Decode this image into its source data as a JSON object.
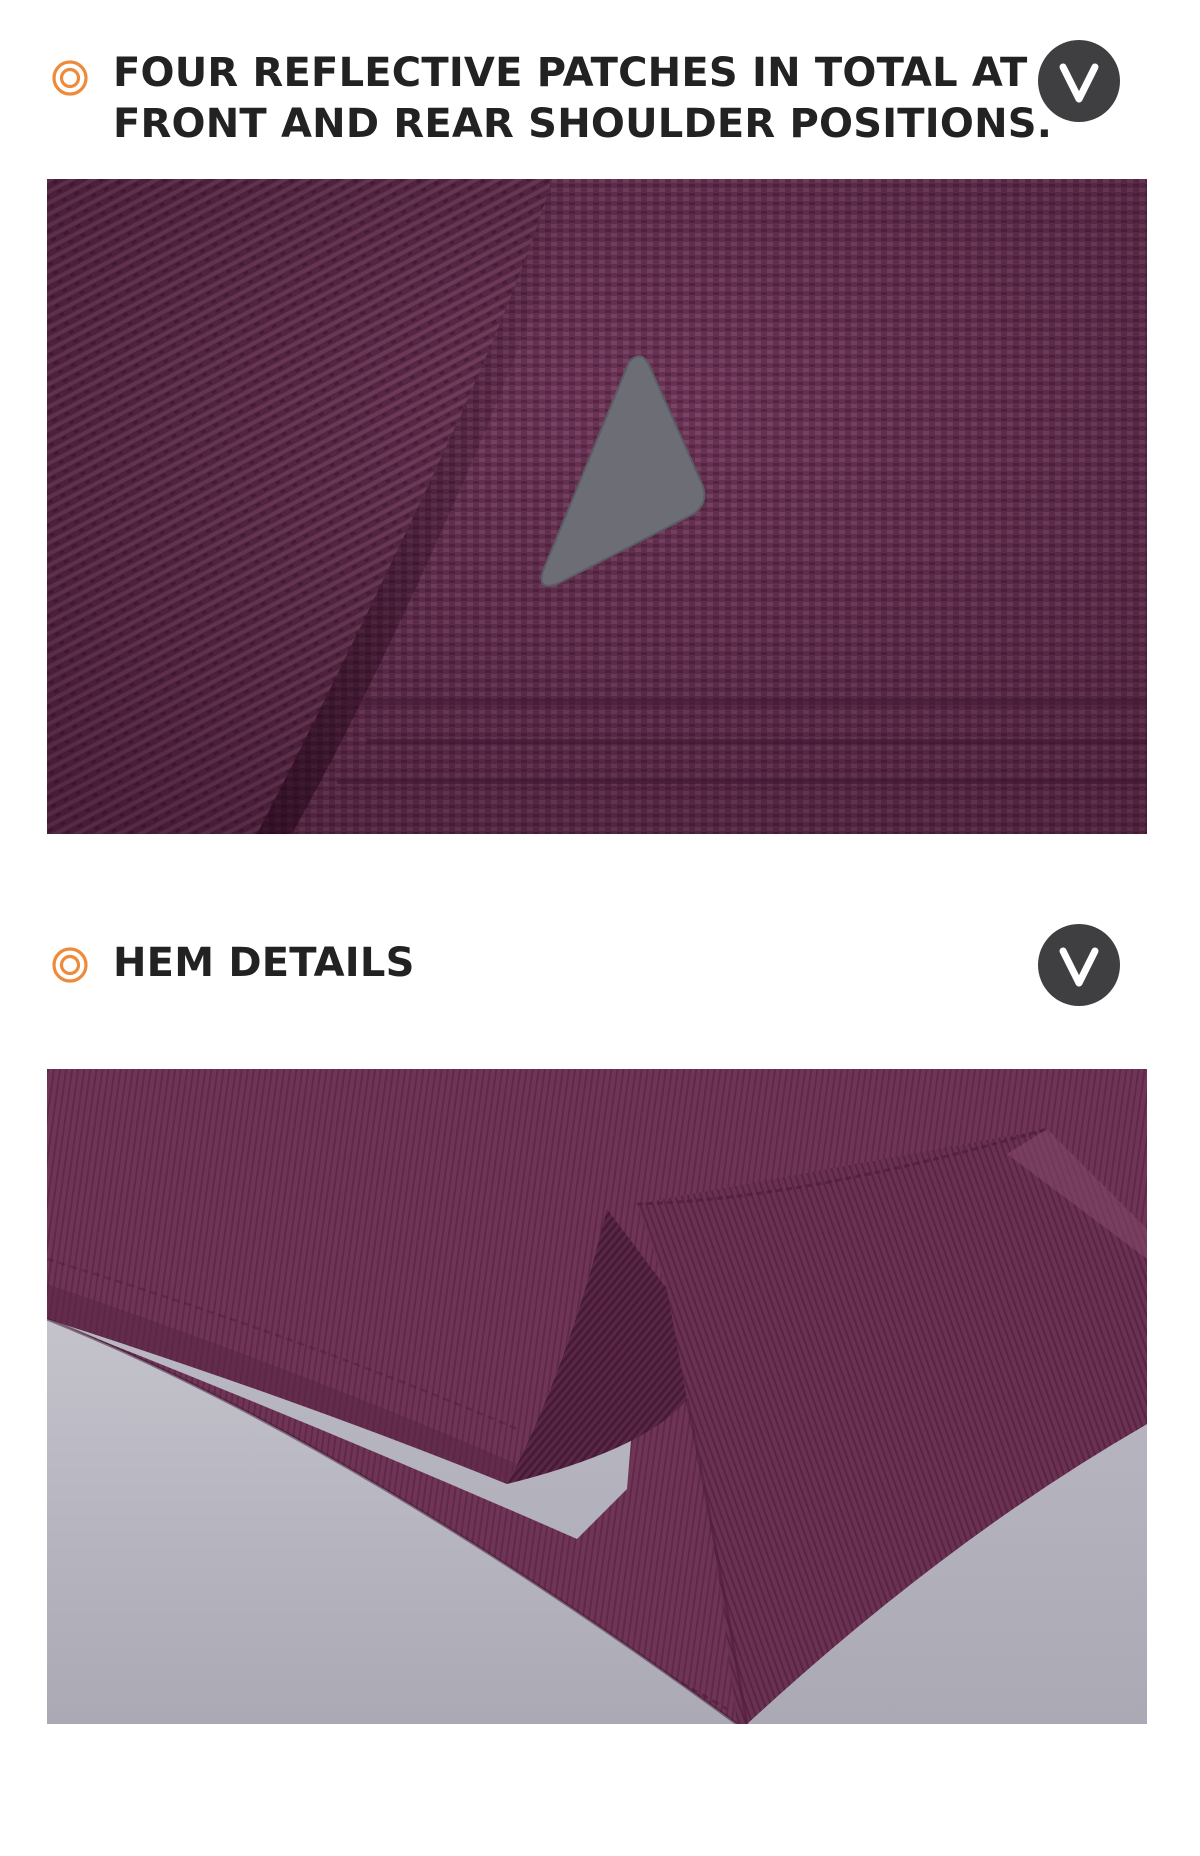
{
  "sections": [
    {
      "heading_lines": [
        "FOUR REFLECTIVE PATCHES IN TOTAL AT",
        "FRONT AND REAR SHOULDER POSITIONS."
      ],
      "badge_icon": "v-chevron-icon",
      "image": "close-up of purple knit fabric at the shoulder seam with a grey triangular reflective patch"
    },
    {
      "heading_lines": [
        "HEM DETAILS"
      ],
      "badge_icon": "v-chevron-icon",
      "image": "close-up of a purple ribbed garment hem with a folded side split on a light grey surface"
    }
  ],
  "colors": {
    "accent_orange": "#ee8a3a",
    "heading_text": "#222222",
    "badge_bg": "#3f3f41",
    "fabric_purple": "#6b3454",
    "patch_grey": "#6d6e75",
    "surface_grey": "#b4b3bd"
  }
}
